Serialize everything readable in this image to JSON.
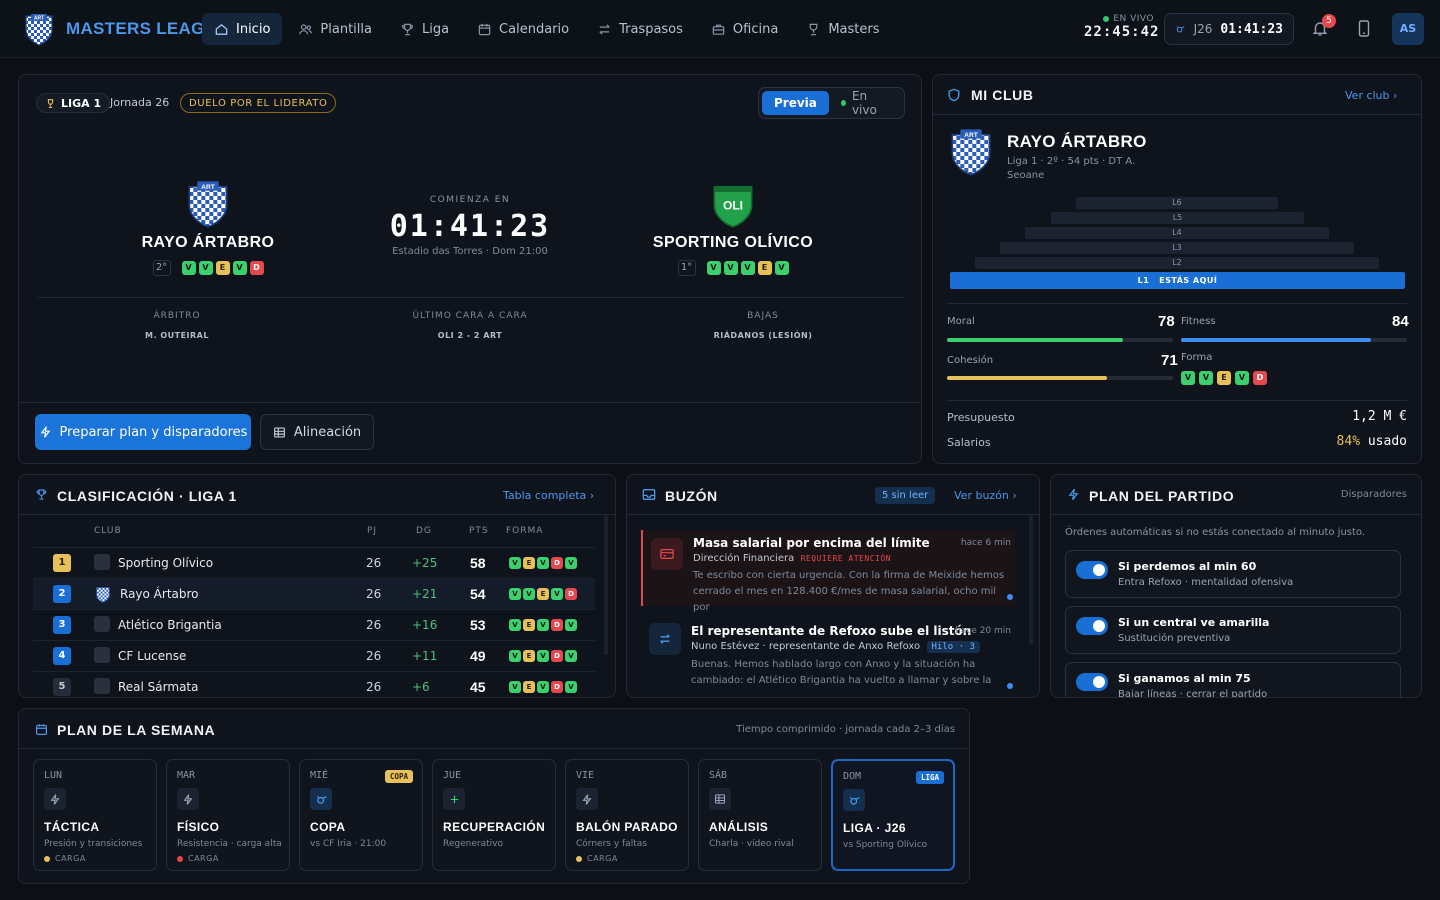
{
  "app": {
    "title": "MASTERS LEAGUE",
    "crest_text": "ART"
  },
  "nav": [
    {
      "label": "Inicio",
      "icon": "home-icon",
      "active": true
    },
    {
      "label": "Plantilla",
      "icon": "users-icon"
    },
    {
      "label": "Liga",
      "icon": "trophy-icon"
    },
    {
      "label": "Calendario",
      "icon": "calendar-icon"
    },
    {
      "label": "Traspasos",
      "icon": "transfer-icon"
    },
    {
      "label": "Oficina",
      "icon": "briefcase-icon"
    },
    {
      "label": "Masters",
      "icon": "cup-icon"
    }
  ],
  "header": {
    "live_label": "EN VIVO",
    "clock": "22:45:42",
    "matchday": "J26",
    "countdown": "01:41:23",
    "notifications": "5",
    "avatar": "AS"
  },
  "match": {
    "league": "LIGA 1",
    "round": "Jornada 26",
    "tag": "DUELO POR EL LIDERATO",
    "toggle": {
      "preview": "Previa",
      "live": "En vivo"
    },
    "home": {
      "name": "RAYO ÁRTABRO",
      "crest": "ART",
      "pos": "2°",
      "form": [
        "V",
        "V",
        "E",
        "V",
        "D"
      ]
    },
    "away": {
      "name": "SPORTING OLÍVICO",
      "crest": "OLI",
      "pos": "1°",
      "form": [
        "V",
        "V",
        "V",
        "E",
        "V"
      ]
    },
    "starts_label": "COMIENZA EN",
    "countdown": "01:41:23",
    "venue": "Estadio das Torres · Dom 21:00",
    "meta": [
      {
        "k": "ÁRBITRO",
        "v": "M. OUTEIRAL"
      },
      {
        "k": "ÚLTIMO CARA A CARA",
        "v": "OLI 2 - 2 ART"
      },
      {
        "k": "BAJAS",
        "v": "RIÁDANOS (LESIÓN)"
      }
    ],
    "btn_plan": "Preparar plan y disparadores",
    "btn_lineup": "Alineación"
  },
  "club": {
    "title": "MI CLUB",
    "link": "Ver club",
    "name": "RAYO ÁRTABRO",
    "crest": "ART",
    "sub1": "Liga 1 · 2º · 54 pts · DT A.",
    "sub2": "Seoane",
    "tiers": [
      "L6",
      "L5",
      "L4",
      "L3",
      "L2"
    ],
    "current_tier": "L1",
    "current_tier_note": "ESTÁS AQUÍ",
    "moral_label": "Moral",
    "moral": 78,
    "fitness_label": "Fitness",
    "fitness": 84,
    "cohesion_label": "Cohesión",
    "cohesion": 71,
    "form_label": "Forma",
    "form": [
      "V",
      "V",
      "E",
      "V",
      "D"
    ],
    "budget_label": "Presupuesto",
    "budget": "1,2 M €",
    "salaries_label": "Salarios",
    "salaries_pct": "84%",
    "salaries_suffix": "usado",
    "colors": {
      "moral": "#3ccf6e",
      "fitness": "#3d8ef0",
      "cohesion": "#e6c15a"
    }
  },
  "standings": {
    "title": "CLASIFICACIÓN · LIGA 1",
    "link": "Tabla completa",
    "headers": {
      "club": "CLUB",
      "pj": "PJ",
      "dg": "DG",
      "pts": "PTS",
      "form": "FORMA"
    },
    "rows": [
      {
        "rank": "1",
        "club": "Sporting Olívico",
        "pj": "26",
        "dg": "+25",
        "pts": "58",
        "form": [
          "V",
          "E",
          "V",
          "D",
          "V"
        ]
      },
      {
        "rank": "2",
        "club": "Rayo Ártabro",
        "pj": "26",
        "dg": "+21",
        "pts": "54",
        "form": [
          "V",
          "V",
          "E",
          "V",
          "D"
        ],
        "me": true
      },
      {
        "rank": "3",
        "club": "Atlético Brigantia",
        "pj": "26",
        "dg": "+16",
        "pts": "53",
        "form": [
          "V",
          "E",
          "V",
          "D",
          "V"
        ]
      },
      {
        "rank": "4",
        "club": "CF Lucense",
        "pj": "26",
        "dg": "+11",
        "pts": "49",
        "form": [
          "V",
          "E",
          "V",
          "D",
          "V"
        ]
      },
      {
        "rank": "5",
        "club": "Real Sármata",
        "pj": "26",
        "dg": "+6",
        "pts": "45",
        "form": [
          "V",
          "E",
          "V",
          "D",
          "V"
        ]
      }
    ]
  },
  "mailbox": {
    "title": "BUZÓN",
    "unread": "5 sin leer",
    "link": "Ver buzón",
    "messages": [
      {
        "title": "Masa salarial por encima del límite",
        "time": "hace 6 min",
        "from": "Dirección Financiera",
        "flag": "REQUIERE ATENCIÓN",
        "body": "Te escribo con cierta urgencia. Con la firma de Meixide hemos cerrado el mes en 128.400 €/mes de masa salarial, ocho mil por"
      },
      {
        "title": "El representante de Refoxo sube el listón",
        "time": "hace 20 min",
        "from": "Nuno Estévez · representante de Anxo Refoxo",
        "thread": "Hilo · 3",
        "body": "Buenas. Hemos hablado largo con Anxo y la situación ha cambiado: el Atlético Brigantia ha vuelto a llamar y sobre la"
      }
    ]
  },
  "plan": {
    "title": "PLAN DEL PARTIDO",
    "subtitle": "Disparadores",
    "desc": "Órdenes automáticas si no estás conectado al minuto justo.",
    "rules": [
      {
        "title": "Si perdemos al min 60",
        "sub": "Entra Refoxo · mentalidad ofensiva"
      },
      {
        "title": "Si un central ve amarilla",
        "sub": "Sustitución preventiva"
      },
      {
        "title": "Si ganamos al min 75",
        "sub": "Bajar líneas · cerrar el partido"
      }
    ]
  },
  "week": {
    "title": "PLAN DE LA SEMANA",
    "note": "Tiempo comprimido · jornada cada 2–3 días",
    "days": [
      {
        "day": "LUN",
        "title": "TÁCTICA",
        "sub": "Presión y transiciones",
        "load": "CARGA",
        "load_color": "#e6c15a",
        "icon": "bolt-icon"
      },
      {
        "day": "MAR",
        "title": "FÍSICO",
        "sub": "Resistencia · carga alta",
        "load": "CARGA",
        "load_color": "#e5484d",
        "icon": "bolt-icon"
      },
      {
        "day": "MIÉ",
        "title": "COPA",
        "sub": "vs CF Iria · 21:00",
        "tag": "COPA",
        "icon": "whistle-icon"
      },
      {
        "day": "JUE",
        "title": "RECUPERACIÓN",
        "sub": "Regenerativo",
        "icon": "plus-icon"
      },
      {
        "day": "VIE",
        "title": "BALÓN PARADO",
        "sub": "Córners y faltas",
        "load": "CARGA",
        "load_color": "#e6c15a",
        "icon": "bolt-icon"
      },
      {
        "day": "SÁB",
        "title": "ANÁLISIS",
        "sub": "Charla · vídeo rival",
        "icon": "grid-icon"
      },
      {
        "day": "DOM",
        "title": "LIGA · J26",
        "sub": "vs Sporting Olívico",
        "tag": "LIGA",
        "icon": "whistle-icon"
      }
    ]
  }
}
